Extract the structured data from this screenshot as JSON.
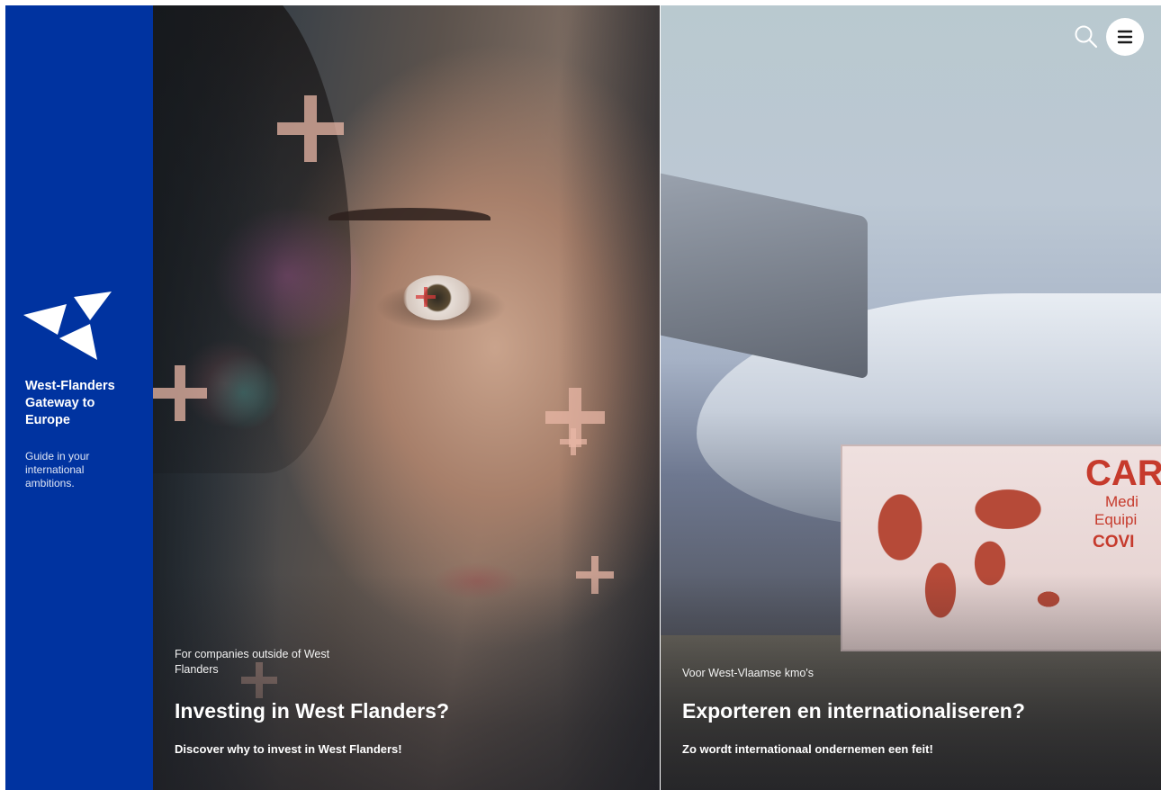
{
  "sidebar": {
    "brand_title": "West-Flanders\nGateway to\nEurope",
    "tagline": "Guide in your international ambitions.",
    "logo_icon": "kite-logo-icon",
    "background_color": "#0033a0"
  },
  "header": {
    "search_icon": "search-icon",
    "menu_icon": "hamburger-menu-icon"
  },
  "panels": [
    {
      "kicker": "For companies outside of West Flanders",
      "headline": "Investing in West Flanders?",
      "subline": "Discover why to invest in West Flanders!"
    },
    {
      "kicker": "Voor West-Vlaamse kmo's",
      "headline": "Exporteren en internationaliseren?",
      "subline": "Zo wordt internationaal ondernemen een feit!",
      "truck_text": [
        "CAR",
        "Medi",
        "Equipi",
        "COVI"
      ]
    }
  ]
}
